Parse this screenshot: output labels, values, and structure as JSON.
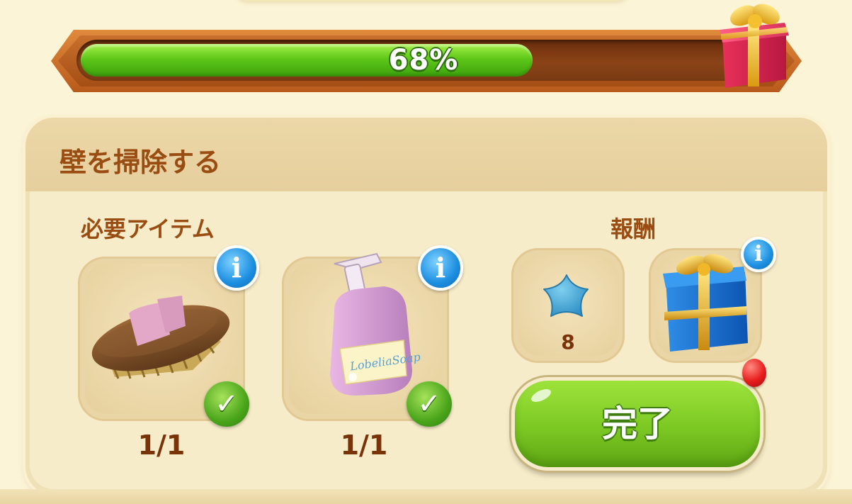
{
  "progress": {
    "value": 0.68,
    "label": "68%",
    "fill_color": "#5ec818"
  },
  "progress_reward_icon": "gift-box-icon",
  "task": {
    "title": "壁を掃除する",
    "required_label": "必要アイテム",
    "reward_label": "報酬",
    "required_items": [
      {
        "icon": "scrub-brush-icon",
        "count": "1/1",
        "completed": true
      },
      {
        "icon": "soap-bottle-icon",
        "count": "1/1",
        "completed": true
      }
    ],
    "rewards": [
      {
        "icon": "blue-star-icon",
        "count": "8"
      },
      {
        "icon": "blue-gift-box-icon"
      }
    ],
    "info_glyph": "i",
    "check_glyph": "✓",
    "soap_brand": "LobeliaSoap"
  },
  "complete_button": {
    "label": "完了",
    "has_notification": true
  }
}
